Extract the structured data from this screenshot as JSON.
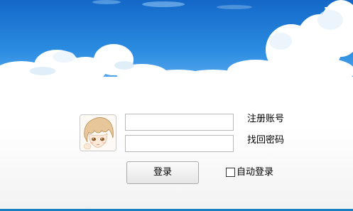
{
  "window": {
    "minimize_icon": "minimize-icon",
    "close_icon": "close-icon"
  },
  "banner": {
    "image": "sky-clouds-banner",
    "sky_color": "#1e86d9"
  },
  "avatar": {
    "image": "anime-avatar"
  },
  "form": {
    "account_value": "",
    "account_placeholder": "",
    "password_value": "",
    "password_placeholder": ""
  },
  "links": {
    "register": "注册账号",
    "recover": "找回密码"
  },
  "login_button": {
    "label": "登录"
  },
  "auto_login": {
    "label": "自动登录",
    "checked": false
  },
  "colors": {
    "accent": "#1a7fbf",
    "button_border": "#a9a9a9",
    "field_border": "#b9b9b9"
  }
}
